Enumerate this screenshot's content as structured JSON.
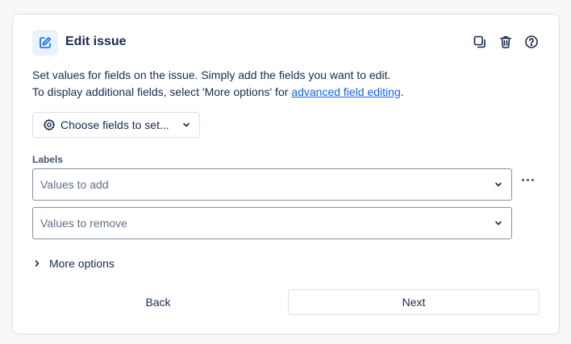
{
  "header": {
    "title": "Edit issue",
    "icon": "edit-pencil-icon",
    "actions": [
      "duplicate-icon",
      "trash-icon",
      "help-icon"
    ]
  },
  "description": {
    "line1": "Set values for fields on the issue. Simply add the fields you want to edit.",
    "line2_prefix": "To display additional fields, select 'More options' for ",
    "line2_link": "advanced field editing",
    "line2_suffix": "."
  },
  "choose_fields": {
    "label": "Choose fields to set..."
  },
  "labels_field": {
    "label": "Labels",
    "add_placeholder": "Values to add",
    "remove_placeholder": "Values to remove"
  },
  "more_options": {
    "label": "More options"
  },
  "footer": {
    "back_label": "Back",
    "next_label": "Next"
  },
  "colors": {
    "accent": "#0c66e4",
    "icon_bg": "#e9f2ff",
    "text": "#172b4d",
    "border": "#dcdfe4"
  }
}
